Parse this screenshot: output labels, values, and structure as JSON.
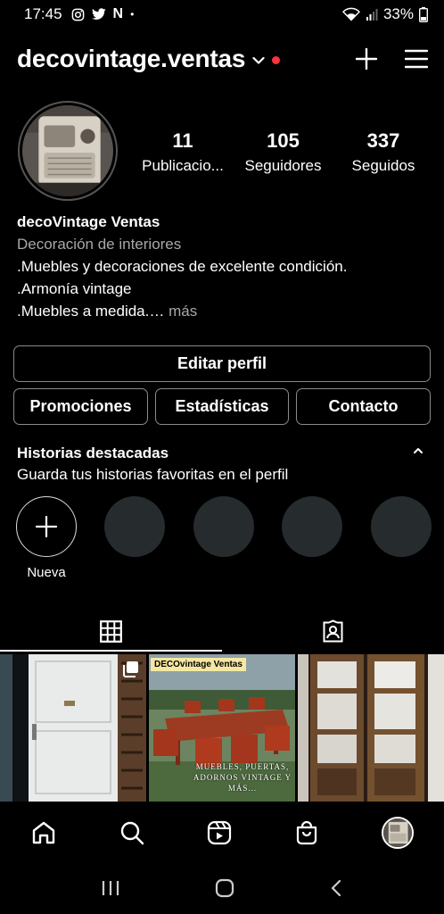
{
  "status_bar": {
    "time": "17:45",
    "notification_letter": "N",
    "battery": "33%"
  },
  "header": {
    "username": "decovintage.ventas"
  },
  "stats": [
    {
      "value": "11",
      "label": "Publicacio..."
    },
    {
      "value": "105",
      "label": "Seguidores"
    },
    {
      "value": "337",
      "label": "Seguidos"
    }
  ],
  "bio": {
    "name": "decoVintage Ventas",
    "category": "Decoración de interiores",
    "line1": ".Muebles y decoraciones de excelente condición.",
    "line2": ".Armonía vintage",
    "line3": ".Muebles a medida.…",
    "more": "más"
  },
  "buttons": {
    "edit": "Editar perfil",
    "promotions": "Promociones",
    "statistics": "Estadísticas",
    "contact": "Contacto"
  },
  "highlights": {
    "title": "Historias destacadas",
    "subtitle": "Guarda tus historias favoritas en el perfil",
    "new_label": "Nueva"
  },
  "posts": {
    "post2_banner": "DECOvintage Ventas",
    "post2_caption": "MUEBLES, PUERTAS, ADORNOS VINTAGE Y MÁS..."
  },
  "colors": {
    "background": "#000000",
    "notification_dot": "#ff3040",
    "secondary_text": "#a8a8a8",
    "highlight_placeholder": "#262b2d"
  }
}
